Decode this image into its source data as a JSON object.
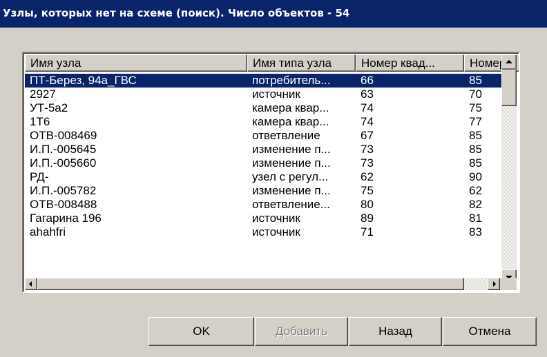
{
  "window": {
    "title": "Узлы, которых нет на схеме (поиск). Число объектов - 54"
  },
  "columns": [
    "Имя узла",
    "Имя типа узла",
    "Номер квад...",
    "Номер"
  ],
  "rows": [
    {
      "name": "ПТ-Берез, 94а_ГВС",
      "type": "потребитель...",
      "sq": "66",
      "num": "85"
    },
    {
      "name": "2927",
      "type": "источник",
      "sq": "63",
      "num": "70"
    },
    {
      "name": "УТ-5а2",
      "type": "камера квар...",
      "sq": "74",
      "num": "75"
    },
    {
      "name": "1Т6",
      "type": "камера квар...",
      "sq": "74",
      "num": "77"
    },
    {
      "name": "ОТВ-008469",
      "type": "ответвление",
      "sq": "67",
      "num": "85"
    },
    {
      "name": "И.П.-005645",
      "type": "изменение п...",
      "sq": "73",
      "num": "85"
    },
    {
      "name": "И.П.-005660",
      "type": "изменение п...",
      "sq": "73",
      "num": "85"
    },
    {
      "name": "РД-",
      "type": "узел с регул...",
      "sq": "62",
      "num": "90"
    },
    {
      "name": "И.П.-005782",
      "type": "изменение п...",
      "sq": "75",
      "num": "62"
    },
    {
      "name": "ОТВ-008488",
      "type": "ответвление...",
      "sq": "80",
      "num": "82"
    },
    {
      "name": "Гагарина 196",
      "type": "источник",
      "sq": "89",
      "num": "81"
    },
    {
      "name": "ahahfri",
      "type": "источник",
      "sq": "71",
      "num": "83"
    }
  ],
  "selected_row": 0,
  "buttons": {
    "ok": "OK",
    "add": "Добавить",
    "back": "Назад",
    "cancel": "Отмена"
  },
  "colors": {
    "selection": "#0a246a",
    "titlebar": "#0a246a",
    "face": "#d4d0c8"
  }
}
